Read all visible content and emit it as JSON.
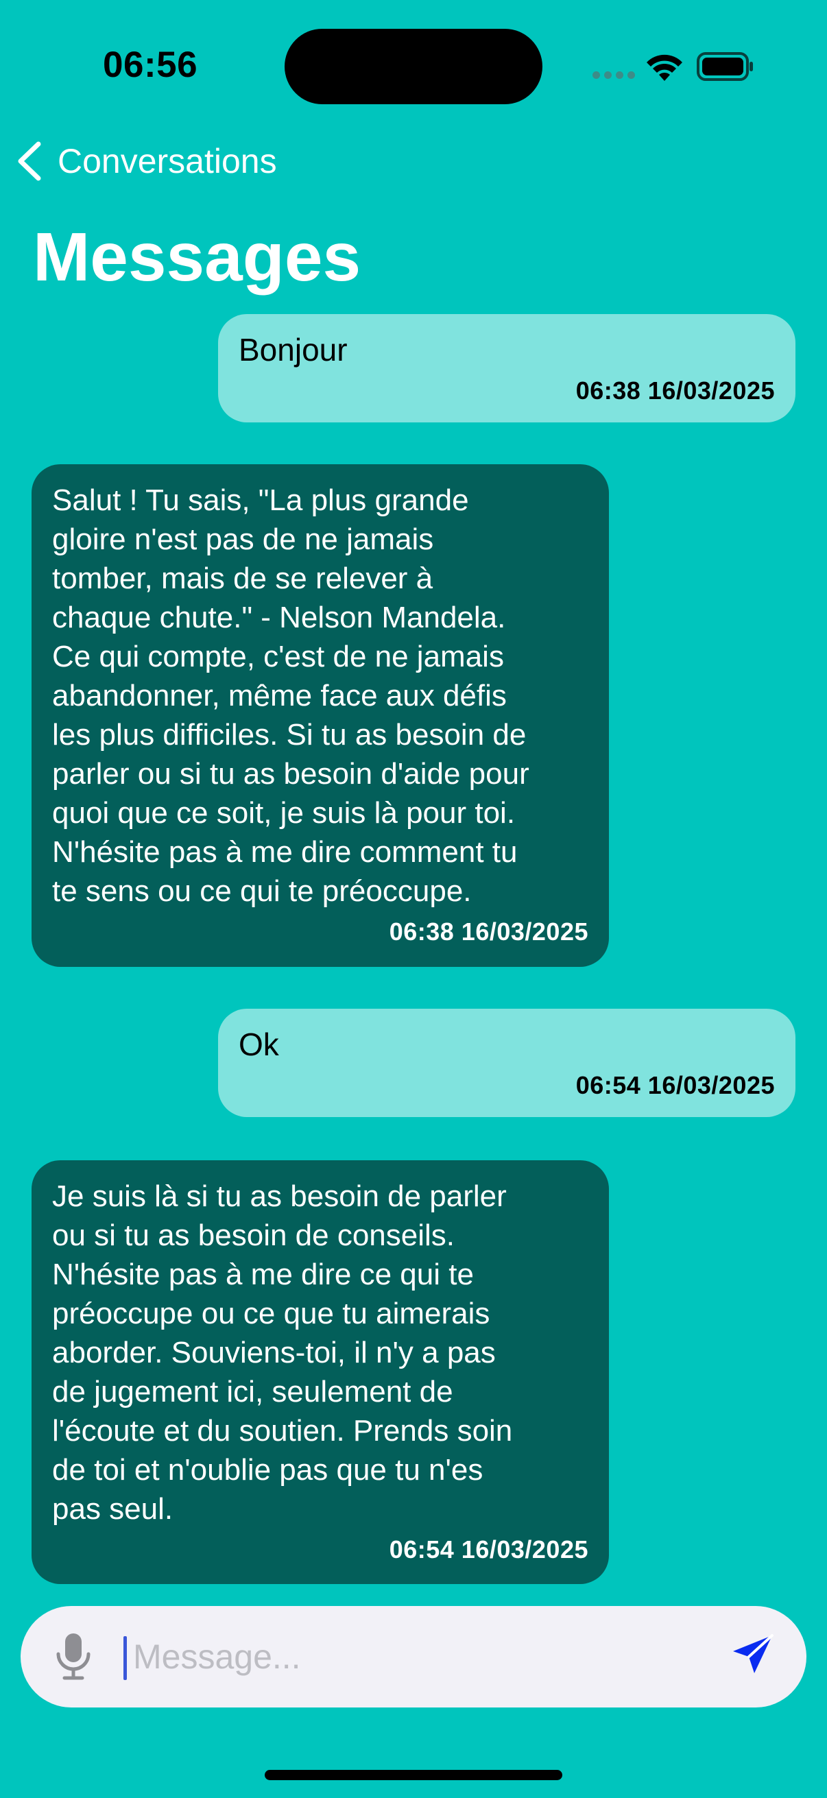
{
  "status_bar": {
    "time": "06:56"
  },
  "nav": {
    "back_label": "Conversations"
  },
  "page": {
    "title": "Messages"
  },
  "messages": [
    {
      "direction": "sent",
      "text": "Bonjour",
      "timestamp": "06:38 16/03/2025"
    },
    {
      "direction": "received",
      "text": "Salut ! Tu sais, \"La plus grande\ngloire n'est pas de ne jamais\ntomber, mais de se relever à\nchaque chute.\" - Nelson Mandela.\nCe qui compte, c'est de ne jamais\nabandonner, même face aux défis\nles plus difficiles. Si tu as besoin de\nparler ou si tu as besoin d'aide pour\nquoi que ce soit, je suis là pour toi.\nN'hésite pas à me dire comment tu\nte sens ou ce qui te préoccupe.",
      "timestamp": "06:38 16/03/2025"
    },
    {
      "direction": "sent",
      "text": "Ok",
      "timestamp": "06:54 16/03/2025"
    },
    {
      "direction": "received",
      "text": "Je suis là si tu as besoin de parler\nou si tu as besoin de conseils.\nN'hésite pas à me dire ce qui te\npréoccupe ou ce que tu aimerais\naborder. Souviens-toi, il n'y a pas\nde jugement ici, seulement de\nl'écoute et du soutien. Prends soin\nde toi et n'oublie pas que tu n'es\npas seul.",
      "timestamp": "06:54 16/03/2025"
    }
  ],
  "composer": {
    "placeholder": "Message...",
    "value": "",
    "mic_icon": "microphone-icon",
    "send_icon": "paper-plane-icon"
  },
  "colors": {
    "background": "#00c5bd",
    "sent_bubble": "#80e3de",
    "received_bubble": "#035f5a",
    "send_accent": "#0a2cf0"
  }
}
